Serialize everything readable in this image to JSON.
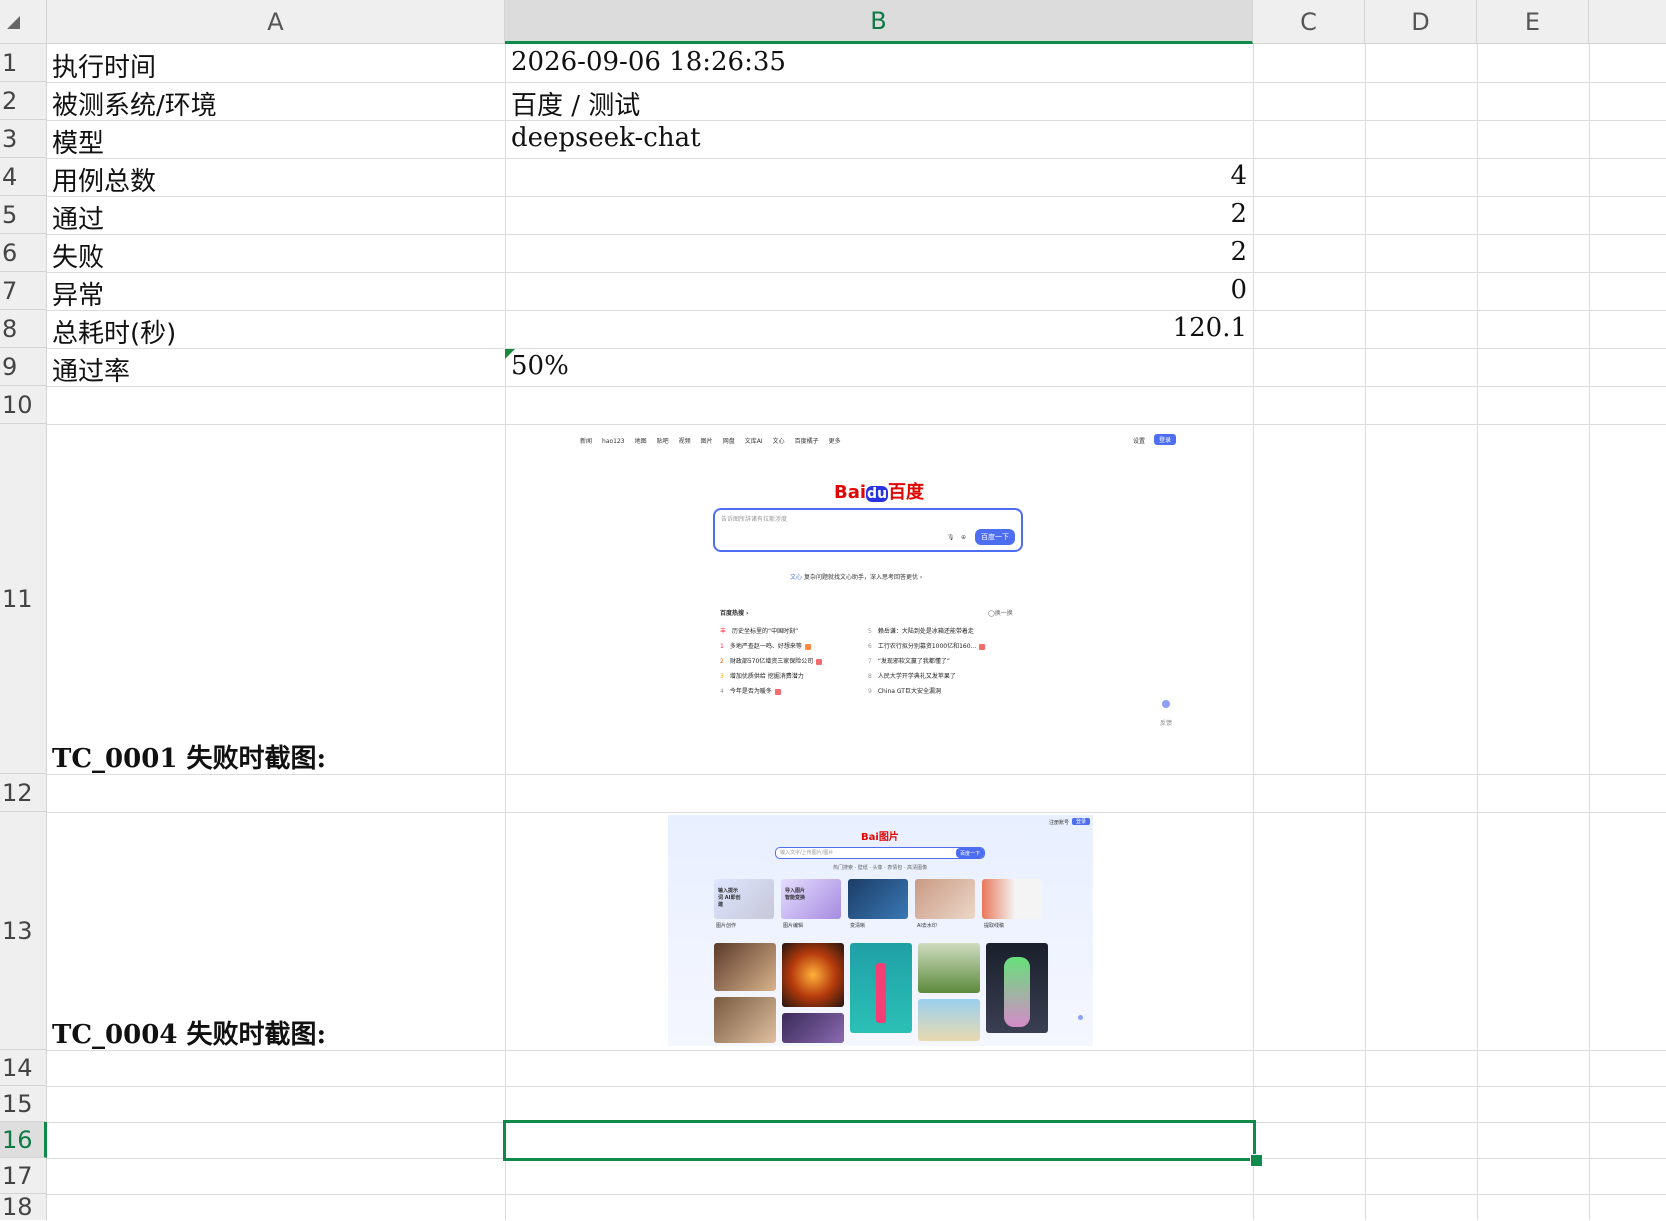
{
  "columns": [
    "A",
    "B",
    "C",
    "D",
    "E"
  ],
  "rows": [
    "1",
    "2",
    "3",
    "4",
    "5",
    "6",
    "7",
    "8",
    "9",
    "10",
    "11",
    "12",
    "13",
    "14",
    "15",
    "16",
    "17",
    "18"
  ],
  "cells": {
    "r1": {
      "label": "执行时间",
      "value": "2026-09-06 18:26:35"
    },
    "r2": {
      "label": "被测系统/环境",
      "value": "百度 / 测试"
    },
    "r3": {
      "label": "模型",
      "value": "deepseek-chat"
    },
    "r4": {
      "label": "用例总数",
      "value": "4"
    },
    "r5": {
      "label": "通过",
      "value": "2"
    },
    "r6": {
      "label": "失败",
      "value": "2"
    },
    "r7": {
      "label": "异常",
      "value": "0"
    },
    "r8": {
      "label": "总耗时(秒)",
      "value": "120.1"
    },
    "r9": {
      "label": "通过率",
      "value": "50%"
    },
    "r11": {
      "label": "TC_0001 失败时截图:"
    },
    "r13": {
      "label": "TC_0004 失败时截图:"
    }
  },
  "screenshot1": {
    "nav": [
      "新闻",
      "hao123",
      "地图",
      "贴吧",
      "视频",
      "图片",
      "网盘",
      "文库AI",
      "文心",
      "百度橘子",
      "更多"
    ],
    "settings": "设置",
    "login": "登录",
    "logo_a": "Bai",
    "logo_b": "du",
    "logo_c": "百度",
    "search_placeholder": "告诉图所辞诸有拉斯涉度",
    "search_button": "百度一下",
    "wenxin_tag": "文心",
    "wenxin_text": "复杂问题就找文心助手，深入思考回答更优 ›",
    "hot_title": "百度热搜 ›",
    "hot_refresh": "◯换一换",
    "hot_left": [
      {
        "n": "丰",
        "t": "历史坐标里的“中国时刻”"
      },
      {
        "n": "1",
        "t": "多地严查赵一鸣、好想来等"
      },
      {
        "n": "2",
        "t": "财政部570亿增资三家保险公司"
      },
      {
        "n": "3",
        "t": "增加优质供给 挖掘消费潜力"
      },
      {
        "n": "4",
        "t": "今年是否为暖冬"
      }
    ],
    "hot_right": [
      {
        "n": "5",
        "t": "赖岳谦：大陆到处是冰箱还能带着走"
      },
      {
        "n": "6",
        "t": "工行农行拟分别募资1000亿和160..."
      },
      {
        "n": "7",
        "t": "“发现邪软文赢了我都懂了”"
      },
      {
        "n": "8",
        "t": "人民大学开学典礼又发苹果了"
      },
      {
        "n": "9",
        "t": "China GT巨大安全漏洞"
      }
    ],
    "side_icon": "反馈"
  },
  "screenshot2": {
    "top_link": "注册账号",
    "login": "登录",
    "logo_a": "Bai",
    "logo_b": "图片",
    "search_placeholder": "输入文字/上传图片/图片",
    "search_button": "百度一下",
    "subnav": "热门搜索 · 壁纸 · 头像 · 表情包 · 高清图像",
    "cards": [
      "图片创作",
      "图片编辑",
      "变清晰",
      "AI去水印",
      "提取线稿"
    ],
    "card1_title": "输入提示词 AI即创建",
    "card2_title": "导入图片 智能变换"
  },
  "colors": {
    "accent": "#0f8a4a",
    "baidu_blue": "#4e6ef2",
    "baidu_red": "#e10601"
  }
}
